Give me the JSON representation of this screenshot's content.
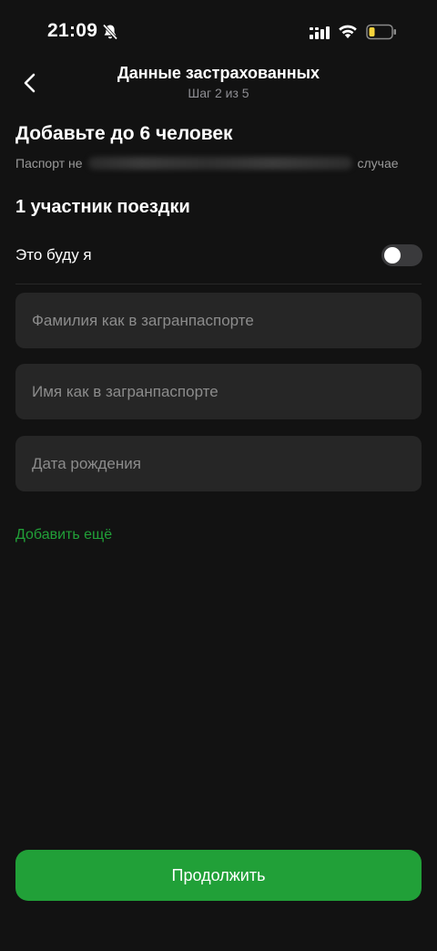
{
  "status_bar": {
    "time": "21:09",
    "icons": [
      "bell-slash-icon",
      "cellular-signal-icon",
      "wifi-icon",
      "battery-low-icon"
    ],
    "battery_color": "#f5d33b"
  },
  "header": {
    "back_icon": "chevron-left-icon",
    "title": "Данные застрахованных",
    "step": "Шаг 2 из 5"
  },
  "main": {
    "heading": "Добавьте до 6 человек",
    "passport_note_start": "Паспорт не",
    "passport_note_end": "случае",
    "participant_title": "1 участник поездки",
    "self_toggle": {
      "label": "Это буду я",
      "on": false
    },
    "fields": {
      "surname": {
        "value": "",
        "placeholder": "Фамилия как в загранпаспорте"
      },
      "name": {
        "value": "",
        "placeholder": "Имя как в загранпаспорте"
      },
      "birthdate": {
        "value": "",
        "placeholder": "Дата рождения"
      }
    },
    "add_more_label": "Добавить ещё"
  },
  "footer": {
    "continue_label": "Продолжить"
  },
  "colors": {
    "background": "#121212",
    "field_bg": "#262626",
    "accent": "#21a038",
    "secondary_text": "#8e8e93"
  }
}
